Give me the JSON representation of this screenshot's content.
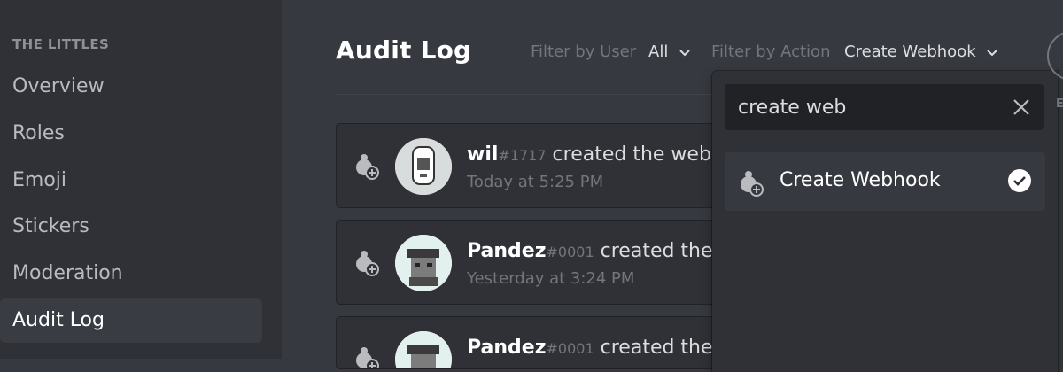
{
  "sidebar": {
    "server_name": "THE LITTLES",
    "items": [
      {
        "label": "Overview"
      },
      {
        "label": "Roles"
      },
      {
        "label": "Emoji"
      },
      {
        "label": "Stickers"
      },
      {
        "label": "Moderation"
      },
      {
        "label": "Audit Log",
        "selected": true
      }
    ]
  },
  "header": {
    "title": "Audit Log",
    "filter_user_label": "Filter by User",
    "filter_user_value": "All",
    "filter_action_label": "Filter by Action",
    "filter_action_value": "Create Webhook"
  },
  "entries": [
    {
      "username": "wil",
      "discriminator": "#1717",
      "action": "created the webhook",
      "time": "Today at 5:25 PM",
      "icon": "webhook-create-icon"
    },
    {
      "username": "Pandez",
      "discriminator": "#0001",
      "action": "created the webhook",
      "time": "Yesterday at 3:24 PM",
      "icon": "webhook-create-icon"
    },
    {
      "username": "Pandez",
      "discriminator": "#0001",
      "action": "created the webhook",
      "time": "",
      "icon": "webhook-create-icon"
    }
  ],
  "dropdown": {
    "search_value": "create web",
    "options": [
      {
        "label": "Create Webhook",
        "selected": true,
        "icon": "webhook-create-icon"
      }
    ]
  },
  "close": {
    "label": "E"
  },
  "colors": {
    "background": "#36393f",
    "sidebar": "#2f3136",
    "popout": "#2f3136",
    "search": "#202225",
    "text_muted": "#72767d"
  }
}
